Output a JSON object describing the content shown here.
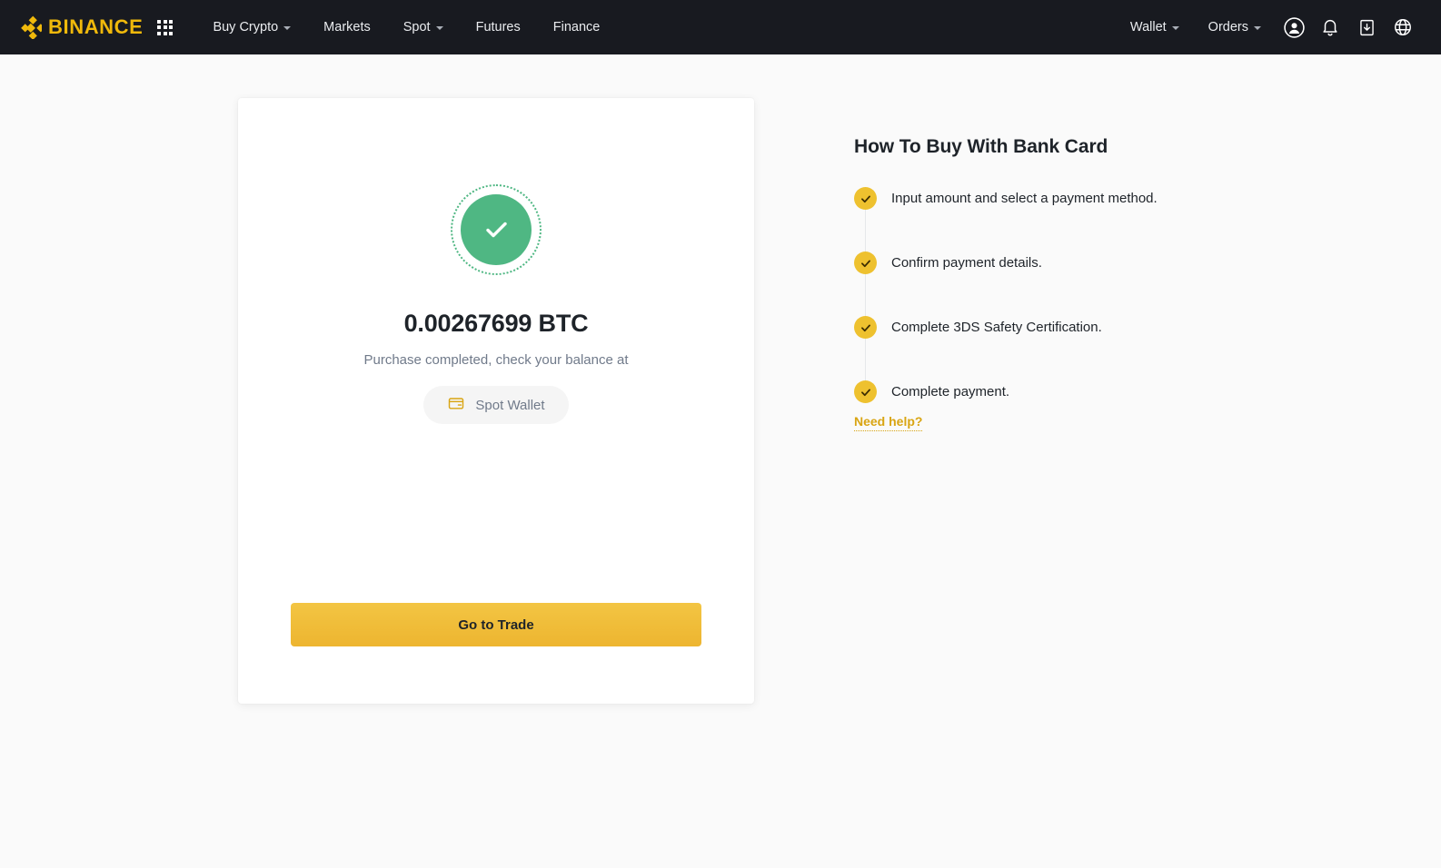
{
  "navbar": {
    "logo_text": "BINANCE",
    "logo_icon": "binance-diamond-logo",
    "apps_icon": "grid-apps-icon",
    "left_links": [
      {
        "label": "Buy Crypto",
        "has_dropdown": true
      },
      {
        "label": "Markets",
        "has_dropdown": false
      },
      {
        "label": "Spot",
        "has_dropdown": true
      },
      {
        "label": "Futures",
        "has_dropdown": false
      },
      {
        "label": "Finance",
        "has_dropdown": false
      }
    ],
    "right_links": [
      {
        "label": "Wallet",
        "has_dropdown": true
      },
      {
        "label": "Orders",
        "has_dropdown": true
      }
    ],
    "icons": [
      {
        "name": "user-profile-icon"
      },
      {
        "name": "notification-bell-icon"
      },
      {
        "name": "download-app-icon"
      },
      {
        "name": "language-globe-icon"
      }
    ],
    "background_color": "#181a20",
    "accent_color": "#f0b90b"
  },
  "result_card": {
    "status_icon": "success-check-icon",
    "status_color": "#4fb783",
    "amount": "0.00267699 BTC",
    "message": "Purchase completed, check your balance at",
    "wallet_pill": {
      "icon": "wallet-card-icon",
      "label": "Spot Wallet"
    },
    "cta_label": "Go to Trade",
    "cta_color": "#f0b90b"
  },
  "guide": {
    "title": "How To Buy With Bank Card",
    "steps": [
      {
        "icon": "check-circle-icon",
        "text": "Input amount and select a payment method."
      },
      {
        "icon": "check-circle-icon",
        "text": "Confirm payment details."
      },
      {
        "icon": "check-circle-icon",
        "text": "Complete 3DS Safety Certification."
      },
      {
        "icon": "check-circle-icon",
        "text": "Complete payment."
      }
    ],
    "help_link": "Need help?",
    "step_icon_color": "#eec12f"
  }
}
